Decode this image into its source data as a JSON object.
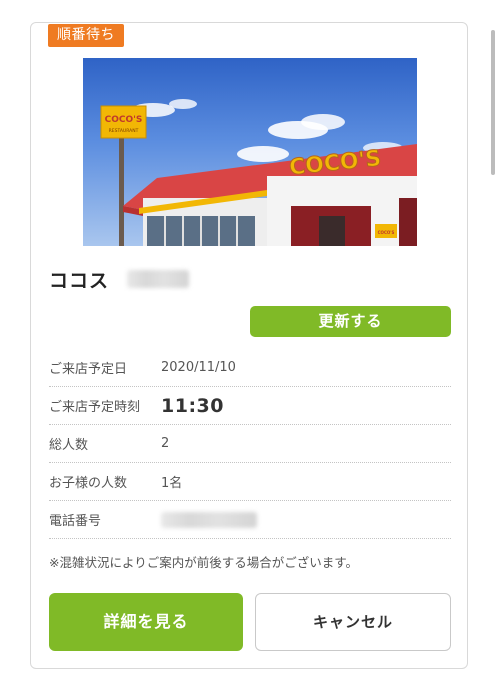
{
  "status_badge": "順番待ち",
  "shop": {
    "name": "ココス",
    "photo": {
      "pole_sign_text": "COCO'S",
      "pole_sign_sub": "RESTAURANT",
      "roof_sign_text": "COCO'S",
      "small_sign_text": "COCO'S"
    }
  },
  "refresh_button": "更新する",
  "info": [
    {
      "label": "ご来店予定日",
      "value": "2020/11/10"
    },
    {
      "label": "ご来店予定時刻",
      "value": "11:30"
    },
    {
      "label": "総人数",
      "value": "2"
    },
    {
      "label": "お子様の人数",
      "value": "1名"
    },
    {
      "label": "電話番号",
      "value": ""
    }
  ],
  "notice": "※混雑状況によりご案内が前後する場合がございます。",
  "buttons": {
    "detail": "詳細を見る",
    "cancel": "キャンセル"
  },
  "colors": {
    "badge": "#ef7b22",
    "accent_green": "#80ba27",
    "sign_yellow": "#f2b705",
    "roof_red": "#d94545"
  }
}
